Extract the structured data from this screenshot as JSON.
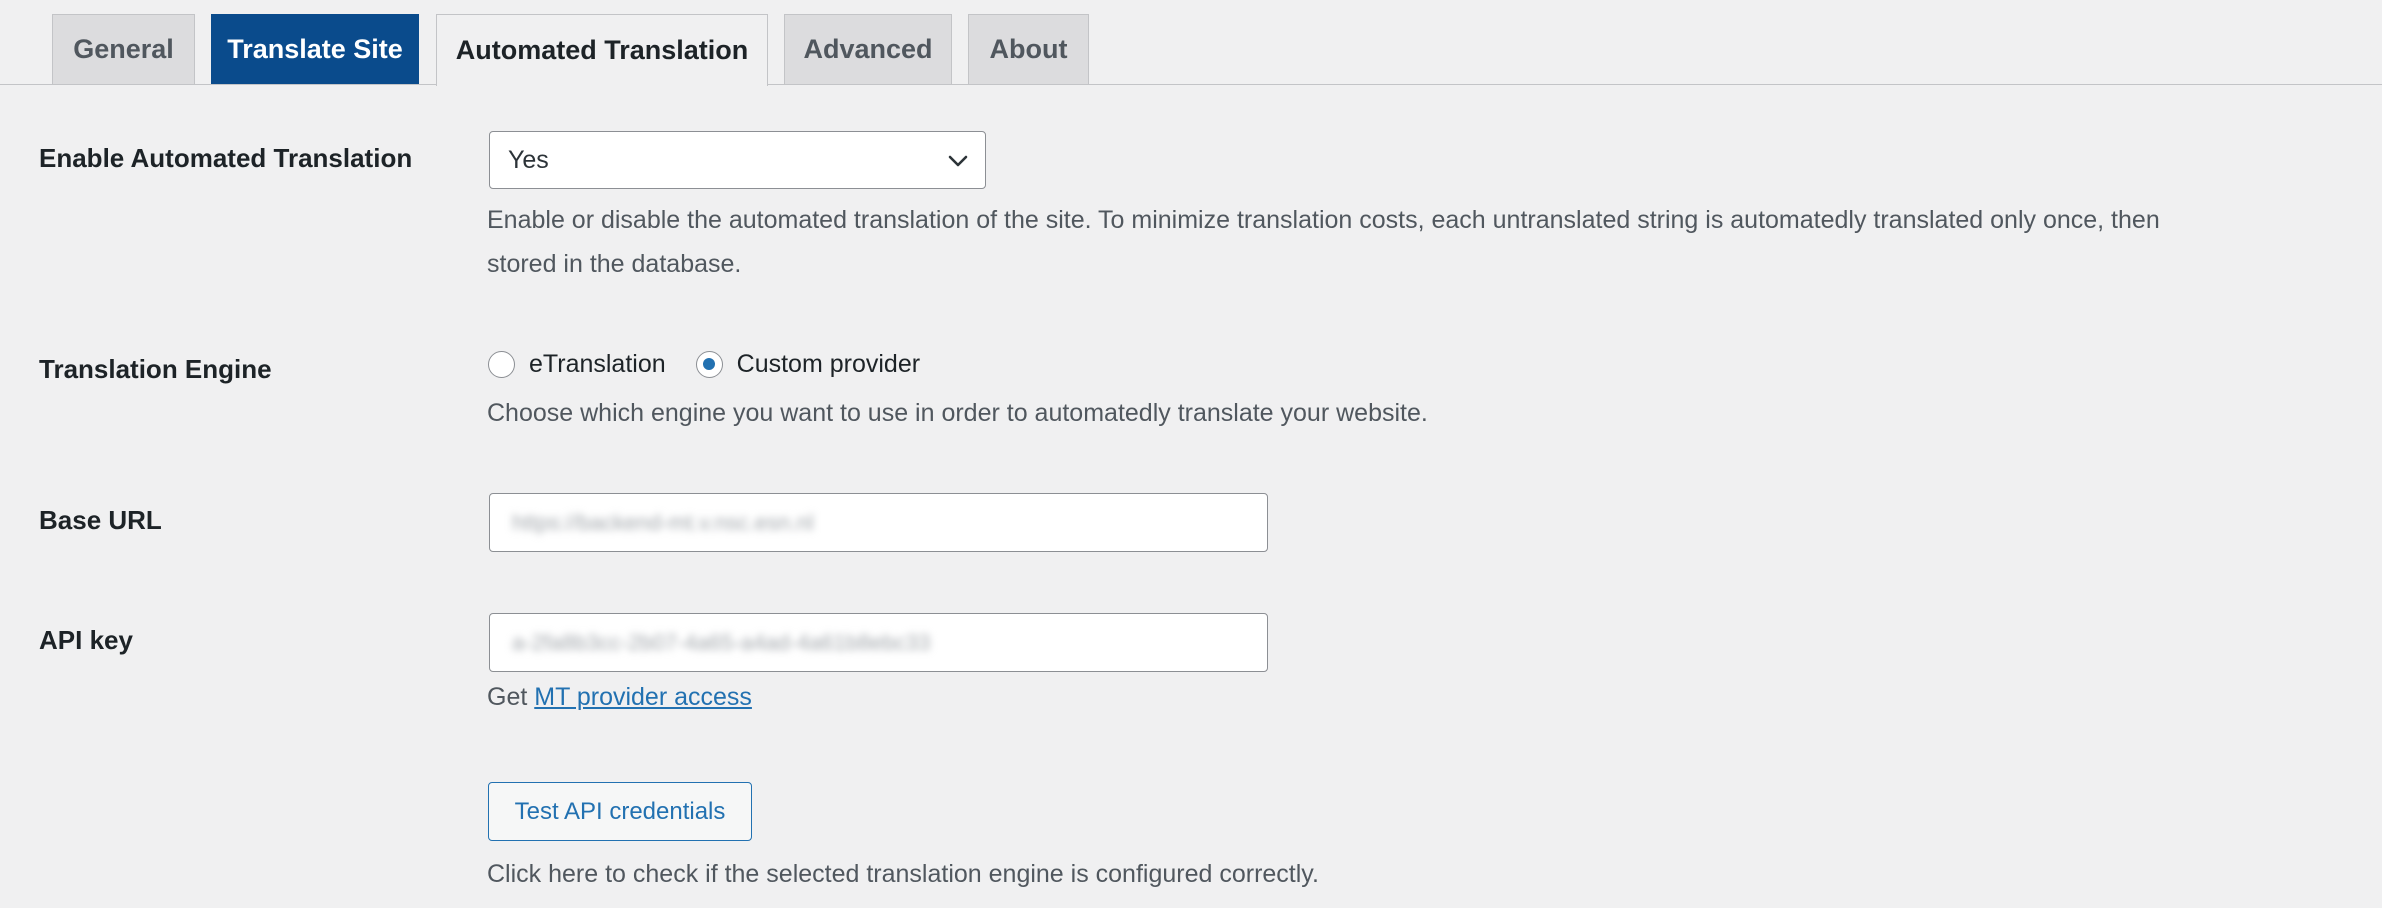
{
  "tabs": [
    {
      "label": "General",
      "state": "inactive"
    },
    {
      "label": "Translate Site",
      "state": "primary"
    },
    {
      "label": "Automated Translation",
      "state": "active"
    },
    {
      "label": "Advanced",
      "state": "inactive"
    },
    {
      "label": "About",
      "state": "inactive"
    }
  ],
  "enable": {
    "label": "Enable Automated Translation",
    "value": "Yes",
    "desc_line1": "Enable or disable the automated translation of the site. To minimize translation costs, each untranslated string is automatedly translated only once, then",
    "desc_line2": "stored in the database."
  },
  "engine": {
    "label": "Translation Engine",
    "options": [
      {
        "label": "eTranslation",
        "checked": false
      },
      {
        "label": "Custom provider",
        "checked": true
      }
    ],
    "desc": "Choose which engine you want to use in order to automatedly translate your website."
  },
  "base_url": {
    "label": "Base URL",
    "value": "https://backend-mt.v.nsc.esn.nl"
  },
  "api_key": {
    "label": "API key",
    "value": "a-2fa8b3cc-2b07-4a65-a4ad-4a61b8ebc33",
    "link_prefix": "Get",
    "link_text": "MT provider access"
  },
  "test": {
    "button_label": "Test API credentials",
    "desc": "Click here to check if the selected translation engine is configured correctly."
  },
  "colors": {
    "accent": "#2271b1",
    "primary_tab": "#0a4b8c",
    "background": "#f0f0f1"
  }
}
